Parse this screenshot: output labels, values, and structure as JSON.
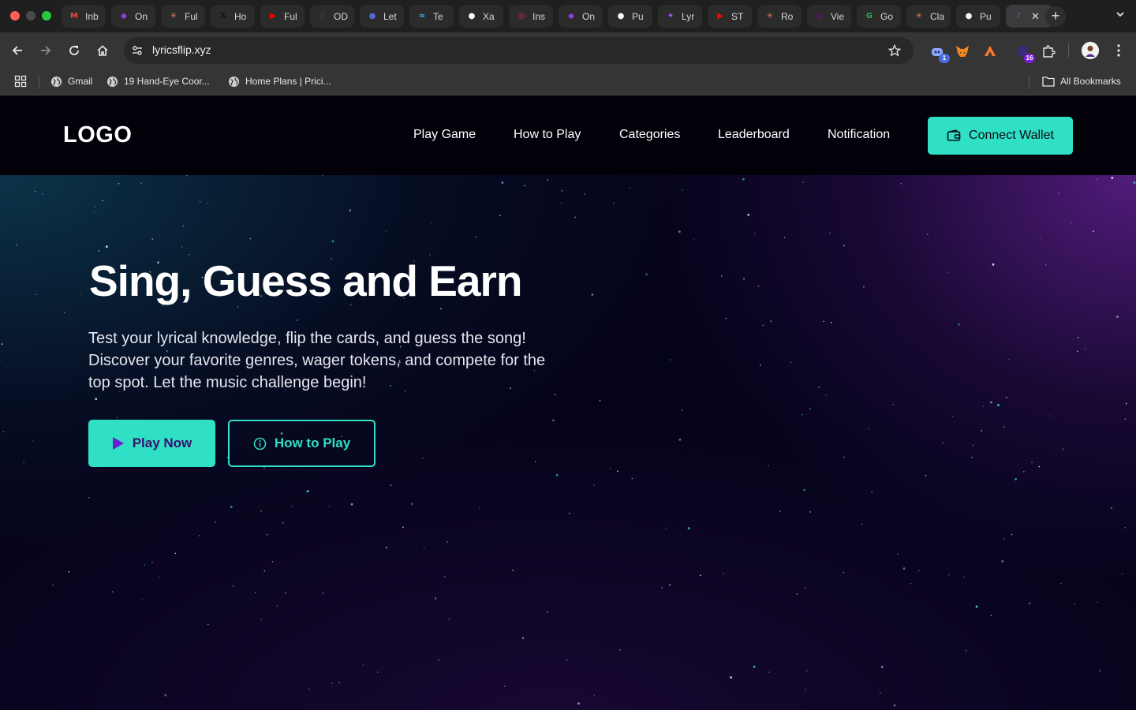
{
  "browser": {
    "tabs": [
      {
        "title": "Inb",
        "icon": "gmail-icon",
        "color": "#ea4335",
        "glyph": "M"
      },
      {
        "title": "On",
        "icon": "app-logo-icon",
        "color": "#8a3ff0",
        "glyph": "◆"
      },
      {
        "title": "Ful",
        "icon": "spark-icon",
        "color": "#e07a4a",
        "glyph": "✳"
      },
      {
        "title": "Ho",
        "icon": "x-icon",
        "color": "#000000",
        "glyph": "𝕏"
      },
      {
        "title": "Ful",
        "icon": "youtube-icon",
        "color": "#ff0000",
        "glyph": "▶"
      },
      {
        "title": "OD",
        "icon": "openai-icon",
        "color": "#444444",
        "glyph": "◎"
      },
      {
        "title": "Let",
        "icon": "avatar-icon",
        "color": "#4a6be0",
        "glyph": "●"
      },
      {
        "title": "Te",
        "icon": "tailwind-icon",
        "color": "#38bdf8",
        "glyph": "≈"
      },
      {
        "title": "Xa",
        "icon": "github-icon",
        "color": "#ffffff",
        "glyph": "●"
      },
      {
        "title": "Ins",
        "icon": "instagram-icon",
        "color": "#d6287a",
        "glyph": "◎"
      },
      {
        "title": "On",
        "icon": "app-logo-icon",
        "color": "#8a3ff0",
        "glyph": "◆"
      },
      {
        "title": "Pu",
        "icon": "github-icon",
        "color": "#ffffff",
        "glyph": "●"
      },
      {
        "title": "Lyr",
        "icon": "figma-icon",
        "color": "#a259ff",
        "glyph": "✦"
      },
      {
        "title": "ST",
        "icon": "youtube-icon",
        "color": "#ff0000",
        "glyph": "▶"
      },
      {
        "title": "Ro",
        "icon": "spark-icon",
        "color": "#e07a4a",
        "glyph": "✳"
      },
      {
        "title": "Vie",
        "icon": "dot-icon",
        "color": "#4a1a5a",
        "glyph": "●"
      },
      {
        "title": "Go",
        "icon": "google-icon",
        "color": "#34a853",
        "glyph": "G"
      },
      {
        "title": "Cla",
        "icon": "spark-icon",
        "color": "#e07a4a",
        "glyph": "✳"
      },
      {
        "title": "Pu",
        "icon": "github-icon",
        "color": "#ffffff",
        "glyph": "●"
      },
      {
        "title": "",
        "icon": "app-icon",
        "color": "#7b5cd6",
        "glyph": "♪",
        "active": true
      }
    ],
    "url": "lyricsflip.xyz",
    "extensions": [
      {
        "name": "copilot-extension-icon",
        "badge": "1",
        "badge_color": "#4a6be0"
      },
      {
        "name": "metamask-extension-icon",
        "badge": ""
      },
      {
        "name": "argent-extension-icon",
        "badge": ""
      },
      {
        "name": "wallet-extension-icon",
        "badge": "16",
        "badge_color": "#7a1fd6"
      }
    ],
    "bookmarks": [
      {
        "label": "Gmail"
      },
      {
        "label": "19 Hand-Eye Coor..."
      },
      {
        "label": "Home Plans | Prici..."
      }
    ],
    "all_bookmarks": "All Bookmarks"
  },
  "site": {
    "logo": "LOGO",
    "nav": [
      "Play Game",
      "How to Play",
      "Categories",
      "Leaderboard",
      "Notification"
    ],
    "connect_wallet": "Connect Wallet",
    "hero": {
      "title": "Sing, Guess and Earn",
      "description": "Test your lyrical knowledge, flip the cards, and guess the song! Discover your favorite genres, wager tokens, and compete for the top spot. Let the music challenge begin!",
      "play_now": "Play Now",
      "how_to_play": "How to Play"
    }
  },
  "colors": {
    "accent": "#2fe0c4",
    "play_text": "#3a1070",
    "header_bg": "#020109"
  }
}
